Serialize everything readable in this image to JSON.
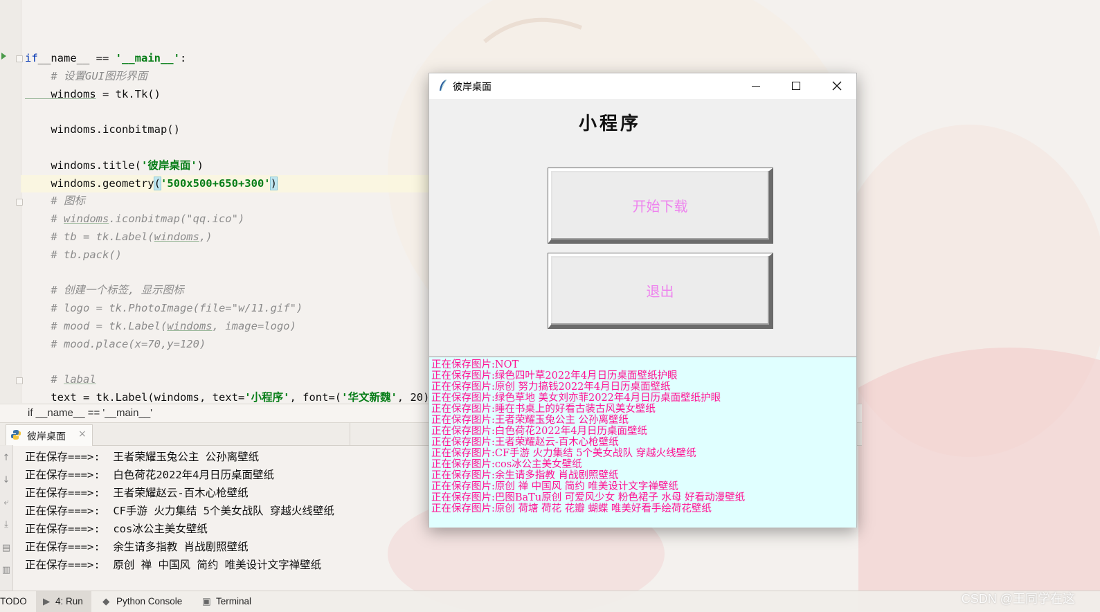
{
  "editor": {
    "lines": [
      {
        "parts": [
          [
            "kw",
            "if"
          ],
          [
            "",
            "__name__ == "
          ],
          [
            "str",
            "'__main__'"
          ],
          [
            "",
            ":"
          ]
        ]
      },
      {
        "parts": [
          [
            "cm",
            "    # 设置GUI图形界面"
          ]
        ]
      },
      {
        "parts": [
          [
            "ul",
            "    windoms"
          ],
          [
            "",
            " = tk.Tk()"
          ]
        ]
      },
      {
        "parts": [
          [
            "",
            ""
          ]
        ]
      },
      {
        "parts": [
          [
            "",
            "    windoms.iconbitmap()"
          ]
        ]
      },
      {
        "parts": [
          [
            "",
            ""
          ]
        ]
      },
      {
        "parts": [
          [
            "",
            "    windoms.title("
          ],
          [
            "str",
            "'彼岸桌面'"
          ],
          [
            "",
            ")"
          ]
        ]
      },
      {
        "parts": [
          [
            "",
            "    windoms.geometry"
          ],
          [
            "brace",
            "("
          ],
          [
            "str",
            "'500x500+650+300'"
          ],
          [
            "brace",
            ")"
          ]
        ]
      },
      {
        "parts": [
          [
            "cm",
            "    # 图标"
          ]
        ]
      },
      {
        "parts": [
          [
            "cm",
            "    # "
          ],
          [
            "cm-ul",
            "windoms"
          ],
          [
            "cm",
            ".iconbitmap(\"qq.ico\")"
          ]
        ]
      },
      {
        "parts": [
          [
            "cm",
            "    # tb = tk.Label("
          ],
          [
            "cm-ul",
            "windoms"
          ],
          [
            "cm",
            ",)"
          ]
        ]
      },
      {
        "parts": [
          [
            "cm",
            "    # tb.pack()"
          ]
        ]
      },
      {
        "parts": [
          [
            "",
            ""
          ]
        ]
      },
      {
        "parts": [
          [
            "cm",
            "    # 创建一个标签, 显示图标"
          ]
        ]
      },
      {
        "parts": [
          [
            "cm",
            "    # logo = tk.PhotoImage(file=\"w/11.gif\")"
          ]
        ]
      },
      {
        "parts": [
          [
            "cm",
            "    # mood = tk.Label("
          ],
          [
            "cm-ul",
            "windoms"
          ],
          [
            "cm",
            ", image=logo)"
          ]
        ]
      },
      {
        "parts": [
          [
            "cm",
            "    # mood.place(x=70,y=120)"
          ]
        ]
      },
      {
        "parts": [
          [
            "",
            ""
          ]
        ]
      },
      {
        "parts": [
          [
            "cm",
            "    # "
          ],
          [
            "cm-ul",
            "labal"
          ]
        ]
      },
      {
        "parts": [
          [
            "",
            "    text = tk.Label(windoms, text="
          ],
          [
            "str",
            "'小程序'"
          ],
          [
            "",
            ", font=("
          ],
          [
            "str",
            "'华文新魏'"
          ],
          [
            "",
            ", 20)"
          ]
        ]
      }
    ]
  },
  "breadcrumb": "if __name__ == '__main__'",
  "run_tab": {
    "label": "彼岸桌面",
    "close": "×"
  },
  "console": [
    "正在保存===>:  王者荣耀玉兔公主 公孙离壁纸",
    "正在保存===>:  白色荷花2022年4月日历桌面壁纸",
    "正在保存===>:  王者荣耀赵云-百木心枪壁纸",
    "正在保存===>:  CF手游 火力集结 5个美女战队 穿越火线壁纸",
    "正在保存===>:  cos冰公主美女壁纸",
    "正在保存===>:  余生请多指教 肖战剧照壁纸",
    "正在保存===>:  原创 禅 中国风 简约 唯美设计文字禅壁纸"
  ],
  "bottom_bar": {
    "todo": "TODO",
    "run": "4: Run",
    "python_console": "Python Console",
    "terminal": "Terminal"
  },
  "watermark": "CSDN @王同学在这",
  "tk_window": {
    "title": "彼岸桌面",
    "label": "小程序",
    "start_button": "开始下载",
    "exit_button": "退出",
    "log": [
      "正在保存图片:NOT",
      "正在保存图片:绿色四叶草2022年4月日历桌面壁纸护眼",
      "正在保存图片:原创 努力搞钱2022年4月日历桌面壁纸",
      "正在保存图片:绿色草地 美女刘亦菲2022年4月日历桌面壁纸护眼",
      "正在保存图片:睡在书桌上的好看古装古风美女壁纸",
      "正在保存图片:王者荣耀玉兔公主 公孙离壁纸",
      "正在保存图片:白色荷花2022年4月日历桌面壁纸",
      "正在保存图片:王者荣耀赵云-百木心枪壁纸",
      "正在保存图片:CF手游 火力集结 5个美女战队 穿越火线壁纸",
      "正在保存图片:cos冰公主美女壁纸",
      "正在保存图片:余生请多指教 肖战剧照壁纸",
      "正在保存图片:原创 禅 中国风 简约 唯美设计文字禅壁纸",
      "正在保存图片:巴图BaTu原创 可爱风少女 粉色裙子 水母 好看动漫壁纸",
      "正在保存图片:原创 荷塘 荷花 花瓣 蝴蝶 唯美好看手绘荷花壁纸"
    ],
    "colors": {
      "button_text": "#ee82ee",
      "log_bg": "#e0ffff",
      "log_text": "#ff1493"
    }
  }
}
